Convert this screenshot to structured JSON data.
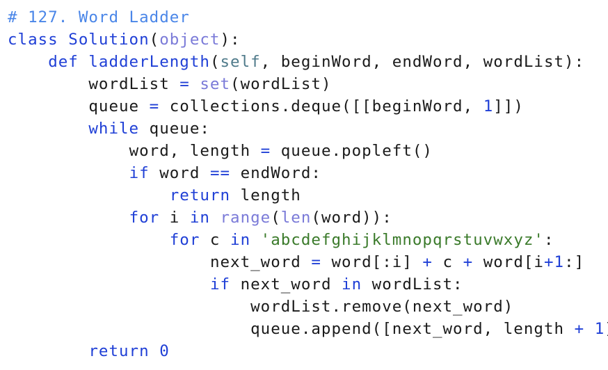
{
  "editor": {
    "colors": {
      "comment": "#4a86e8",
      "keyword": "#1f3fd6",
      "builtin": "#7a7ad8",
      "self": "#4f7a8a",
      "string": "#3a7a2a",
      "plain": "#1a1a1a",
      "background": "#ffffff"
    },
    "lines": [
      {
        "indent": 0,
        "tokens": [
          {
            "t": "# 127. Word Ladder",
            "k": "comment"
          }
        ]
      },
      {
        "indent": 0,
        "tokens": [
          {
            "t": "class",
            "k": "keyword"
          },
          {
            "t": " ",
            "k": "plain"
          },
          {
            "t": "Solution",
            "k": "class"
          },
          {
            "t": "(",
            "k": "plain"
          },
          {
            "t": "object",
            "k": "builtin"
          },
          {
            "t": "):",
            "k": "plain"
          }
        ]
      },
      {
        "indent": 1,
        "tokens": [
          {
            "t": "def",
            "k": "keyword"
          },
          {
            "t": " ",
            "k": "plain"
          },
          {
            "t": "ladderLength",
            "k": "def"
          },
          {
            "t": "(",
            "k": "plain"
          },
          {
            "t": "self",
            "k": "self"
          },
          {
            "t": ", beginWord, endWord, wordList):",
            "k": "plain"
          }
        ]
      },
      {
        "indent": 2,
        "tokens": [
          {
            "t": "wordList ",
            "k": "plain"
          },
          {
            "t": "=",
            "k": "op"
          },
          {
            "t": " ",
            "k": "plain"
          },
          {
            "t": "set",
            "k": "builtin"
          },
          {
            "t": "(wordList)",
            "k": "plain"
          }
        ]
      },
      {
        "indent": 2,
        "tokens": [
          {
            "t": "queue ",
            "k": "plain"
          },
          {
            "t": "=",
            "k": "op"
          },
          {
            "t": " collections.deque([[beginWord, ",
            "k": "plain"
          },
          {
            "t": "1",
            "k": "number"
          },
          {
            "t": "]])",
            "k": "plain"
          }
        ]
      },
      {
        "indent": 2,
        "tokens": [
          {
            "t": "while",
            "k": "keyword"
          },
          {
            "t": " queue:",
            "k": "plain"
          }
        ]
      },
      {
        "indent": 3,
        "tokens": [
          {
            "t": "word, length ",
            "k": "plain"
          },
          {
            "t": "=",
            "k": "op"
          },
          {
            "t": " queue.popleft()",
            "k": "plain"
          }
        ]
      },
      {
        "indent": 3,
        "tokens": [
          {
            "t": "if",
            "k": "keyword"
          },
          {
            "t": " word ",
            "k": "plain"
          },
          {
            "t": "==",
            "k": "op"
          },
          {
            "t": " endWord:",
            "k": "plain"
          }
        ]
      },
      {
        "indent": 4,
        "tokens": [
          {
            "t": "return",
            "k": "keyword"
          },
          {
            "t": " length",
            "k": "plain"
          }
        ]
      },
      {
        "indent": 3,
        "tokens": [
          {
            "t": "for",
            "k": "keyword"
          },
          {
            "t": " i ",
            "k": "plain"
          },
          {
            "t": "in",
            "k": "keyword"
          },
          {
            "t": " ",
            "k": "plain"
          },
          {
            "t": "range",
            "k": "builtin"
          },
          {
            "t": "(",
            "k": "plain"
          },
          {
            "t": "len",
            "k": "builtin"
          },
          {
            "t": "(word)):",
            "k": "plain"
          }
        ]
      },
      {
        "indent": 4,
        "tokens": [
          {
            "t": "for",
            "k": "keyword"
          },
          {
            "t": " c ",
            "k": "plain"
          },
          {
            "t": "in",
            "k": "keyword"
          },
          {
            "t": " ",
            "k": "plain"
          },
          {
            "t": "'abcdefghijklmnopqrstuvwxyz'",
            "k": "string"
          },
          {
            "t": ":",
            "k": "plain"
          }
        ]
      },
      {
        "indent": 5,
        "tokens": [
          {
            "t": "next_word ",
            "k": "plain"
          },
          {
            "t": "=",
            "k": "op"
          },
          {
            "t": " word[:i] ",
            "k": "plain"
          },
          {
            "t": "+",
            "k": "op"
          },
          {
            "t": " c ",
            "k": "plain"
          },
          {
            "t": "+",
            "k": "op"
          },
          {
            "t": " word[i",
            "k": "plain"
          },
          {
            "t": "+",
            "k": "op"
          },
          {
            "t": "1",
            "k": "number"
          },
          {
            "t": ":]",
            "k": "plain"
          }
        ]
      },
      {
        "indent": 5,
        "tokens": [
          {
            "t": "if",
            "k": "keyword"
          },
          {
            "t": " next_word ",
            "k": "plain"
          },
          {
            "t": "in",
            "k": "keyword"
          },
          {
            "t": " wordList:",
            "k": "plain"
          }
        ]
      },
      {
        "indent": 6,
        "tokens": [
          {
            "t": "wordList.remove(next_word)",
            "k": "plain"
          }
        ]
      },
      {
        "indent": 6,
        "tokens": [
          {
            "t": "queue.append([next_word, length ",
            "k": "plain"
          },
          {
            "t": "+",
            "k": "op"
          },
          {
            "t": " ",
            "k": "plain"
          },
          {
            "t": "1",
            "k": "number"
          },
          {
            "t": "])",
            "k": "plain"
          }
        ]
      },
      {
        "indent": 2,
        "tokens": [
          {
            "t": "return",
            "k": "keyword"
          },
          {
            "t": " ",
            "k": "plain"
          },
          {
            "t": "0",
            "k": "number"
          }
        ]
      }
    ]
  }
}
